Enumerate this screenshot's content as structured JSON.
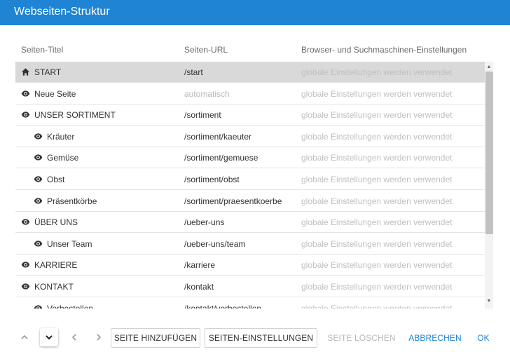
{
  "header": {
    "title": "Webseiten-Struktur"
  },
  "columns": {
    "title": "Seiten-Titel",
    "url": "Seiten-URL",
    "browser": "Browser- und Suchmaschinen-Einstellungen"
  },
  "rows": [
    {
      "icon": "home-icon",
      "indent": 0,
      "title": "START",
      "url": "/start",
      "browser": "globale Einstellungen werden verwendet",
      "selected": true,
      "url_muted": false
    },
    {
      "icon": "eye-icon",
      "indent": 0,
      "title": "Neue Seite",
      "url": "automatisch",
      "browser": "globale Einstellungen werden verwendet",
      "selected": false,
      "url_muted": true
    },
    {
      "icon": "eye-icon",
      "indent": 0,
      "title": "UNSER SORTIMENT",
      "url": "/sortiment",
      "browser": "globale Einstellungen werden verwendet",
      "selected": false,
      "url_muted": false
    },
    {
      "icon": "eye-icon",
      "indent": 1,
      "title": "Kräuter",
      "url": "/sortiment/kaeuter",
      "browser": "globale Einstellungen werden verwendet",
      "selected": false,
      "url_muted": false
    },
    {
      "icon": "eye-icon",
      "indent": 1,
      "title": "Gemüse",
      "url": "/sortiment/gemuese",
      "browser": "globale Einstellungen werden verwendet",
      "selected": false,
      "url_muted": false
    },
    {
      "icon": "eye-icon",
      "indent": 1,
      "title": "Obst",
      "url": "/sortiment/obst",
      "browser": "globale Einstellungen werden verwendet",
      "selected": false,
      "url_muted": false
    },
    {
      "icon": "eye-icon",
      "indent": 1,
      "title": "Präsentkörbe",
      "url": "/sortiment/praesentkoerbe",
      "browser": "globale Einstellungen werden verwendet",
      "selected": false,
      "url_muted": false
    },
    {
      "icon": "eye-icon",
      "indent": 0,
      "title": "ÜBER UNS",
      "url": "/ueber-uns",
      "browser": "globale Einstellungen werden verwendet",
      "selected": false,
      "url_muted": false
    },
    {
      "icon": "eye-icon",
      "indent": 1,
      "title": "Unser Team",
      "url": "/ueber-uns/team",
      "browser": "globale Einstellungen werden verwendet",
      "selected": false,
      "url_muted": false
    },
    {
      "icon": "eye-icon",
      "indent": 0,
      "title": "KARRIERE",
      "url": "/karriere",
      "browser": "globale Einstellungen werden verwendet",
      "selected": false,
      "url_muted": false
    },
    {
      "icon": "eye-icon",
      "indent": 0,
      "title": "KONTAKT",
      "url": "/kontakt",
      "browser": "globale Einstellungen werden verwendet",
      "selected": false,
      "url_muted": false
    },
    {
      "icon": "eye-icon",
      "indent": 1,
      "title": "Vorbestellen",
      "url": "/kontakt/vorbestellen",
      "browser": "globale Einstellungen werden verwendet",
      "selected": false,
      "url_muted": false
    }
  ],
  "footer": {
    "add_page": "SEITE HINZUFÜGEN",
    "page_settings": "SEITEN-EINSTELLUNGEN",
    "delete_page": "SEITE LÖSCHEN",
    "cancel": "ABBRECHEN",
    "ok": "OK"
  },
  "colors": {
    "accent": "#1f84d3",
    "selected_row": "#d9d9d9",
    "muted_text": "#c0c0c0"
  }
}
